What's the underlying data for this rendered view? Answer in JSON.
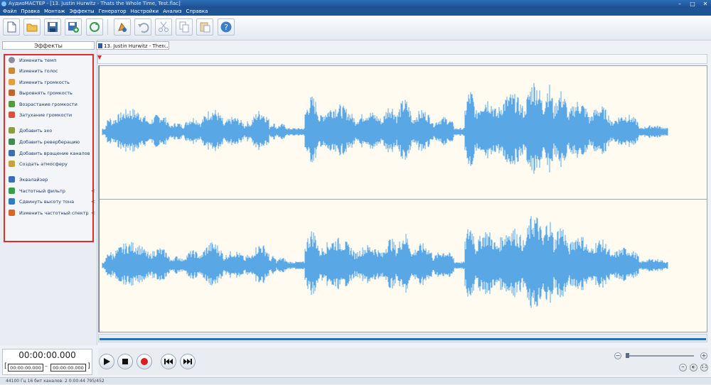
{
  "window": {
    "title": "АудиоМАСТЕР - [13. Justin Hurwitz - Thats the Whole Time, Test.flac]",
    "controls": [
      "–",
      "□",
      "✕"
    ]
  },
  "menu": [
    "Файл",
    "Правка",
    "Монтаж",
    "Эффекты",
    "Генератор",
    "Настройки",
    "Анализ",
    "Справка"
  ],
  "toolbar": {
    "icons": [
      "new-file-icon",
      "open-folder-icon",
      "save-icon",
      "save-as-icon",
      "refresh-icon",
      "audio-edit-icon",
      "undo-icon",
      "cut-icon",
      "copy-icon",
      "paste-icon",
      "help-icon"
    ]
  },
  "left_panel": {
    "header": "Эффекты",
    "items": [
      {
        "label": "Изменить темп",
        "icon": "tempo-icon",
        "color": "#8a8f99"
      },
      {
        "label": "Изменить голос",
        "icon": "voice-icon",
        "color": "#c98a3a"
      },
      {
        "label": "Изменить громкость",
        "icon": "volume-icon",
        "color": "#e0a33a"
      },
      {
        "label": "Выровнять громкость",
        "icon": "normalize-icon",
        "color": "#c0662c"
      },
      {
        "label": "Возрастание громкости",
        "icon": "fade-in-icon",
        "color": "#4e9b3c"
      },
      {
        "label": "Затухание громкости",
        "icon": "fade-out-icon",
        "color": "#d4543a"
      },
      {
        "label": "Добавить эхо",
        "icon": "echo-icon",
        "color": "#8aa03a"
      },
      {
        "label": "Добавить реверберацию",
        "icon": "reverb-icon",
        "color": "#3d8e4f"
      },
      {
        "label": "Добавить вращение каналов",
        "icon": "rotate-channels-icon",
        "color": "#3a6fb0"
      },
      {
        "label": "Создать атмосферу",
        "icon": "atmosphere-icon",
        "color": "#c9a23a"
      },
      {
        "label": "Эквалайзер",
        "icon": "equalizer-icon",
        "color": "#3a6fb0"
      },
      {
        "label": "Частотный фильтр",
        "icon": "filter-icon",
        "color": "#3d9b4a",
        "arrow": "<"
      },
      {
        "label": "Сдвинуть высоту тона",
        "icon": "pitch-icon",
        "color": "#2f7cc1",
        "arrow": "<"
      },
      {
        "label": "Изменить частотный спектр",
        "icon": "spectrum-icon",
        "color": "#d6662c",
        "arrow": "<"
      }
    ]
  },
  "tab": {
    "label": "13. Justin Hurwitz - Ther...",
    "close": "×"
  },
  "waveform": {
    "color": "#5aa7e6",
    "background": "#fffbf0"
  },
  "time": {
    "current": "00:00:00.000",
    "start": "00:00:00.000",
    "end": "00:00:00.000",
    "bracket_open": "[",
    "bracket_close": "]",
    "dash": "–"
  },
  "transport": {
    "icons": [
      "play-icon",
      "stop-icon",
      "record-icon",
      "skip-back-icon",
      "skip-forward-icon"
    ]
  },
  "zoom": {
    "minus": "−",
    "plus": "+"
  },
  "status": {
    "text": "44100 Гц  16 бит  каналов: 2   0:00:44 795/452"
  }
}
